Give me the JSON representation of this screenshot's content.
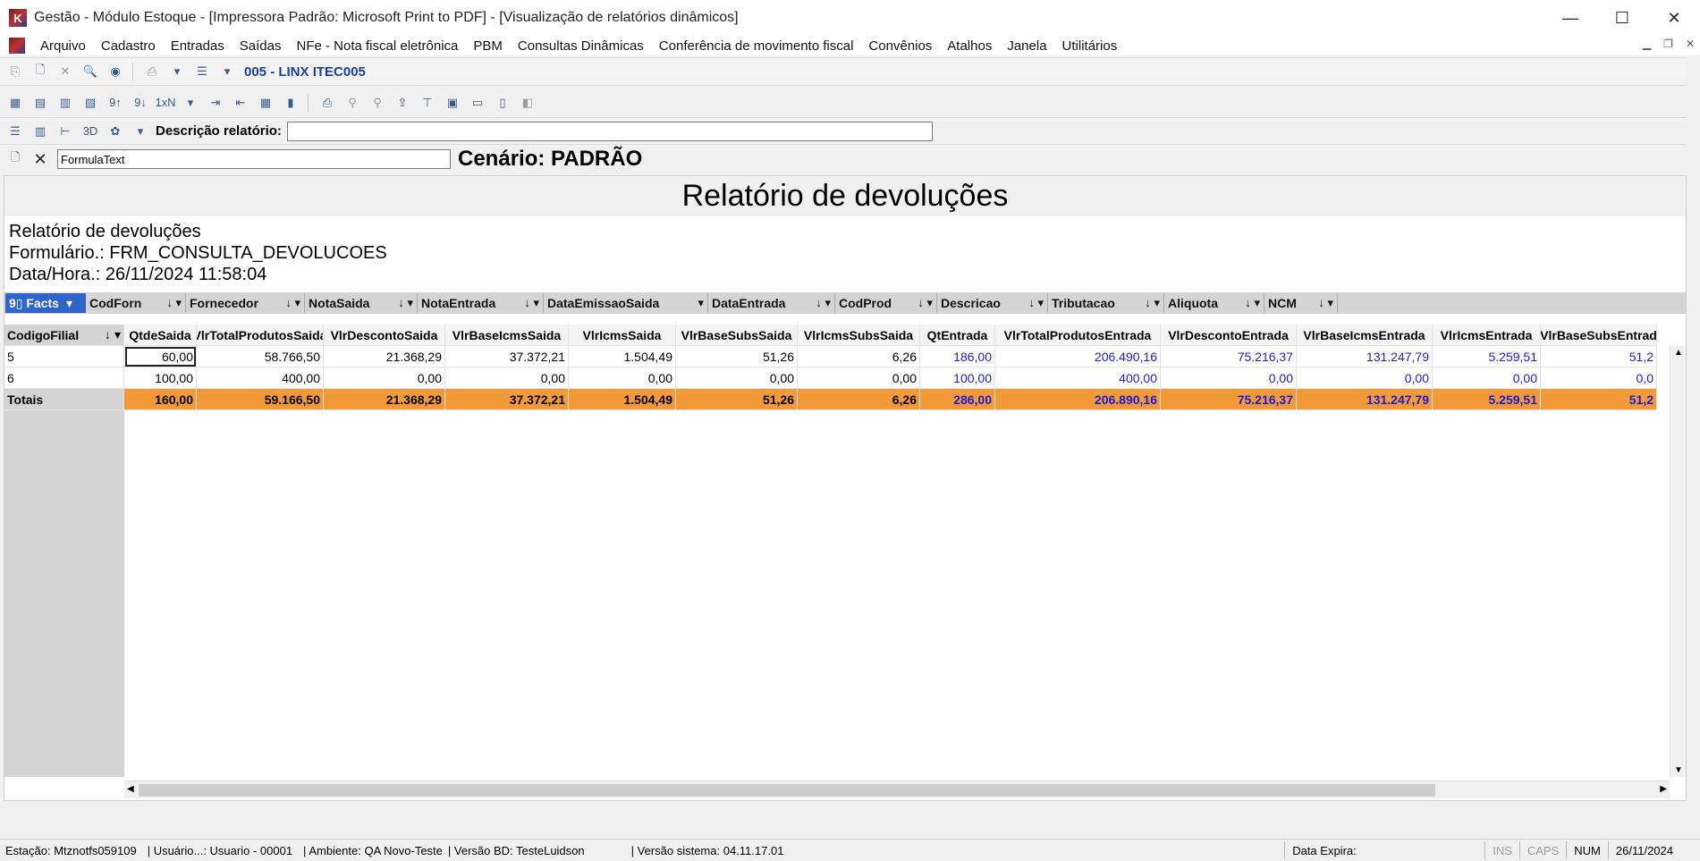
{
  "window": {
    "title": "Gestão  - Módulo Estoque - [Impressora Padrão: Microsoft Print to PDF] - [Visualização de relatórios dinâmicos]",
    "controls": {
      "minimize": "—",
      "maximize": "☐",
      "close": "✕"
    }
  },
  "menu": [
    "Arquivo",
    "Cadastro",
    "Entradas",
    "Saídas",
    "NFe - Nota fiscal eletrônica",
    "PBM",
    "Consultas Dinâmicas",
    "Conferência de movimento fiscal",
    "Convênios",
    "Atalhos",
    "Janela",
    "Utilitários"
  ],
  "toolbar": {
    "printer_combo": "005 - LINX ITEC005",
    "description_label": "Descrição relatório:",
    "description_value": "",
    "formula_value": "FormulaText",
    "scenario": "Cenário: PADRÃO"
  },
  "report": {
    "title": "Relatório de devoluções",
    "info_line1": "Relatório de devoluções",
    "info_line2": "Formulário.: FRM_CONSULTA_DEVOLUCOES",
    "info_line3": "Data/Hora.: 26/11/2024 11:58:04"
  },
  "pivot": {
    "facts_label": "Facts",
    "dimensions": [
      "CodForn",
      "Fornecedor",
      "NotaSaida",
      "NotaEntrada",
      "DataEmissaoSaida",
      "DataEntrada",
      "CodProd",
      "Descricao",
      "Tributacao",
      "Aliquota",
      "NCM"
    ],
    "row_field": "CodigoFilial",
    "columns": [
      "QtdeSaida",
      "VlrTotalProdutosSaida",
      "VlrDescontoSaida",
      "VlrBaseIcmsSaida",
      "VlrIcmsSaida",
      "VlrBaseSubsSaida",
      "VlrIcmsSubsSaida",
      "QtEntrada",
      "VlrTotalProdutosEntrada",
      "VlrDescontoEntrada",
      "VlrBaseIcmsEntrada",
      "VlrIcmsEntrada",
      "VlrBaseSubsEntrad"
    ],
    "rows": [
      {
        "label": "5",
        "cells": [
          "60,00",
          "58.766,50",
          "21.368,29",
          "37.372,21",
          "1.504,49",
          "51,26",
          "6,26",
          "186,00",
          "206.490,16",
          "75.216,37",
          "131.247,79",
          "5.259,51",
          "51,2"
        ]
      },
      {
        "label": "6",
        "cells": [
          "100,00",
          "400,00",
          "0,00",
          "0,00",
          "0,00",
          "0,00",
          "0,00",
          "100,00",
          "400,00",
          "0,00",
          "0,00",
          "0,00",
          "0,0"
        ]
      }
    ],
    "totals": {
      "label": "Totais",
      "cells": [
        "160,00",
        "59.166,50",
        "21.368,29",
        "37.372,21",
        "1.504,49",
        "51,26",
        "6,26",
        "286,00",
        "206.890,16",
        "75.216,37",
        "131.247,79",
        "5.259,51",
        "51,2"
      ]
    }
  },
  "status": {
    "estacao": "Estação: Mtznotfs059109",
    "usuario": "| Usuário...: Usuario - 00001",
    "ambiente": "| Ambiente: QA Novo-Teste",
    "versao_bd": "| Versão BD: TesteLuidson",
    "versao_sistema": "| Versão sistema: 04.11.17.01",
    "data_expira": "Data Expira:",
    "ins": "INS",
    "caps": "CAPS",
    "num": "NUM",
    "date": "26/11/2024"
  },
  "colors": {
    "accent_blue": "#2f64c8",
    "totals_orange": "#f39a38",
    "entrada_blue": "#2020d0"
  }
}
